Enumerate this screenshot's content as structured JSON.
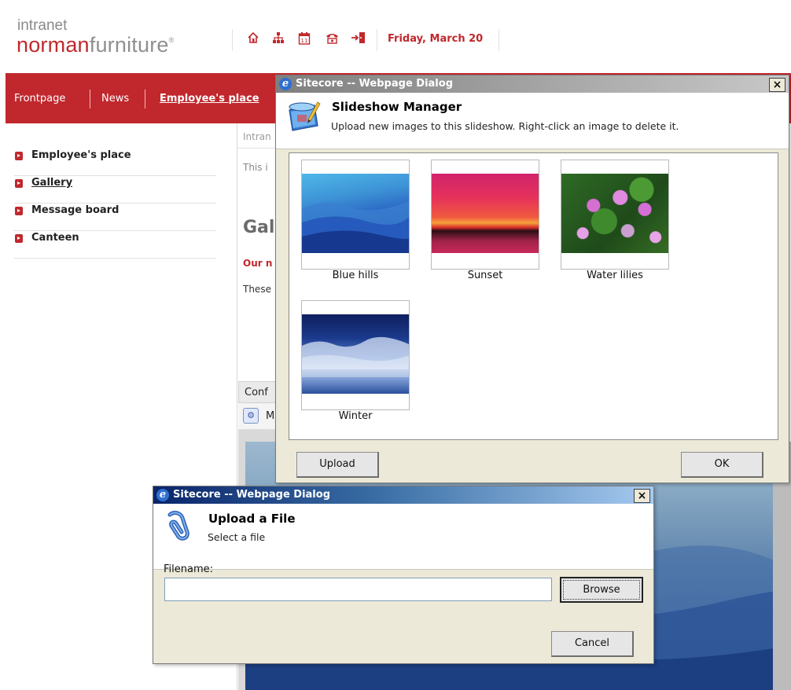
{
  "header": {
    "logo_small": "intranet",
    "logo_red": "norman",
    "logo_gray": "furniture",
    "logo_mark": "®",
    "icons": [
      "home-icon",
      "sitemap-icon",
      "calendar-icon",
      "phone-icon",
      "logout-icon"
    ],
    "date": "Friday, March 20"
  },
  "nav": {
    "items": [
      "Frontpage",
      "News",
      "Employee's place"
    ],
    "active": "Employee's place"
  },
  "sidebar": {
    "items": [
      "Employee's place",
      "Gallery",
      "Message board",
      "Canteen"
    ],
    "current": "Gallery"
  },
  "content": {
    "breadcrumb": "Intran",
    "intro": "This i",
    "heading": "Gal",
    "subheading": "Our n",
    "paragraph": "These",
    "conf_bar": "Conf",
    "conf_row": "M"
  },
  "slideshow_dialog": {
    "window_title": "Sitecore -- Webpage Dialog",
    "close_label": "×",
    "title": "Slideshow Manager",
    "description": "Upload new images to this slideshow. Right-click an image to delete it.",
    "images": [
      {
        "caption": "Blue hills"
      },
      {
        "caption": "Sunset"
      },
      {
        "caption": "Water lilies"
      },
      {
        "caption": "Winter"
      }
    ],
    "upload_label": "Upload",
    "ok_label": "OK"
  },
  "upload_dialog": {
    "window_title": "Sitecore -- Webpage Dialog",
    "close_label": "×",
    "title": "Upload a File",
    "description": "Select a file",
    "filename_label": "Filename:",
    "filename_value": "",
    "browse_label": "Browse",
    "cancel_label": "Cancel"
  },
  "colors": {
    "brand_red": "#c0282d",
    "dialog_bg": "#ece9d8",
    "active_title": "#0a246a"
  }
}
